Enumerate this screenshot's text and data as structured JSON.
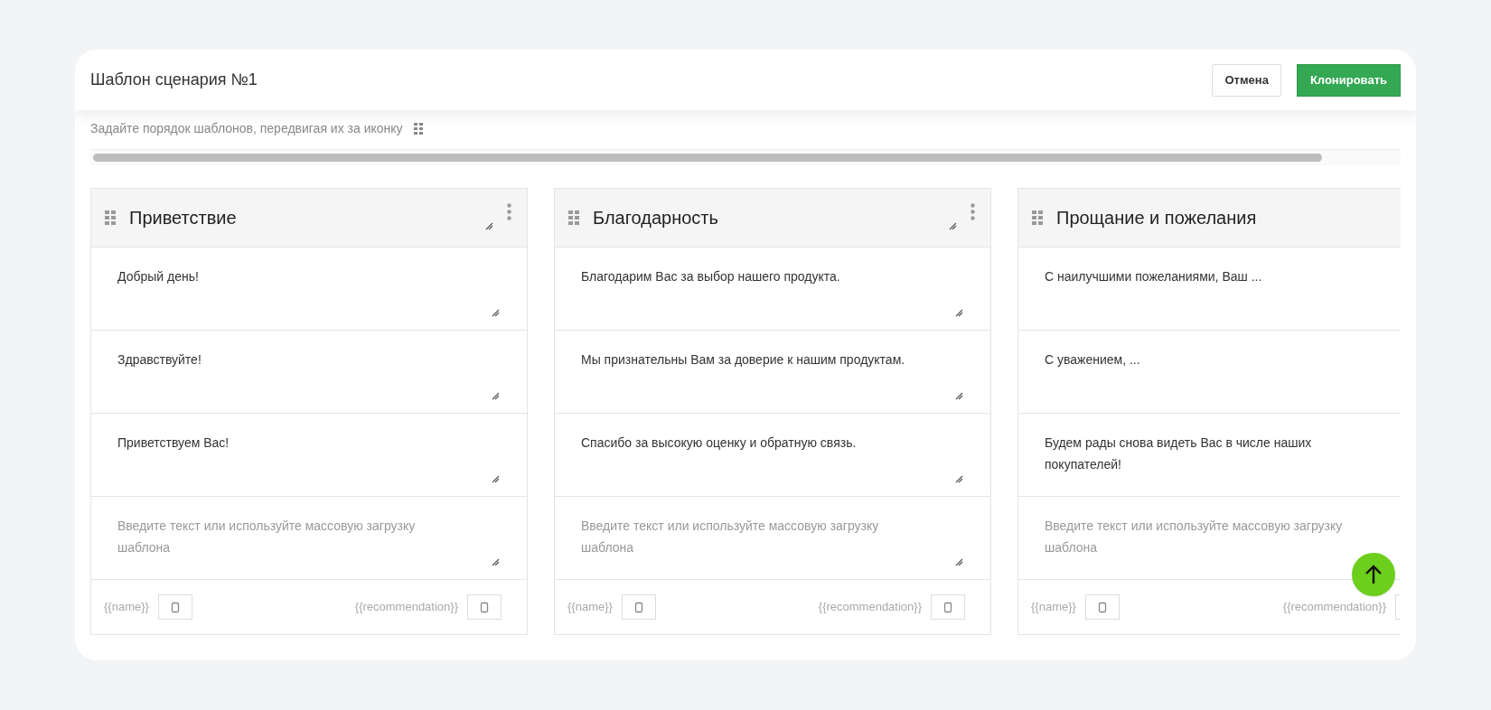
{
  "header": {
    "title": "Шаблон сценария №1",
    "buttons": [
      {
        "label": "Отмена",
        "kind": "secondary"
      },
      {
        "label": "Клонировать",
        "kind": "primary"
      }
    ]
  },
  "hint": "Задайте порядок шаблонов, передвигая их за иконку",
  "columns": [
    {
      "title": "Приветствие",
      "cut_off": false,
      "rows": [
        {
          "text": "Добрый день!"
        },
        {
          "text": "Здравствуйте!"
        },
        {
          "text": "Приветствуем Вас!"
        },
        {
          "placeholder": "Введите текст или используйте массовую загрузку шаблона"
        }
      ],
      "variables": [
        "{{name}}",
        "{{recommendation}}"
      ]
    },
    {
      "title": "Благодарность",
      "cut_off": false,
      "rows": [
        {
          "text": "Благодарим Вас за выбор нашего продукта."
        },
        {
          "text": "Мы признательны Вам за доверие к нашим продуктам."
        },
        {
          "text": "Спасибо за высокую оценку и обратную связь."
        },
        {
          "placeholder": "Введите текст или используйте массовую загрузку шаблона"
        }
      ],
      "variables": [
        "{{name}}",
        "{{recommendation}}"
      ]
    },
    {
      "title": "Прощание и пожелания",
      "cut_off": true,
      "rows": [
        {
          "text": "С наилучшими пожеланиями, Ваш ..."
        },
        {
          "text": "С уважением, ..."
        },
        {
          "text": "Будем рады снова видеть Вас в числе наших покупателей!"
        },
        {
          "placeholder": "Введите текст или используйте массовую загрузку шаблона"
        }
      ],
      "variables": [
        "{{name}}",
        "{{recommendation}}"
      ]
    }
  ]
}
